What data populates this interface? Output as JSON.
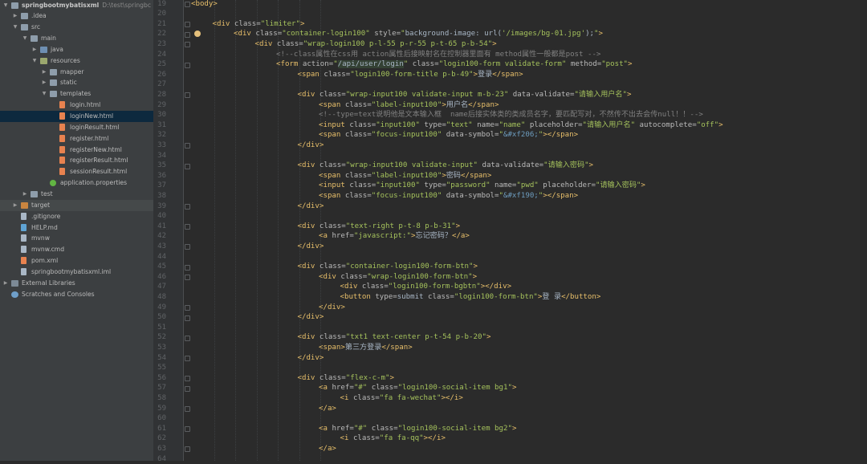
{
  "project_tree": [
    {
      "label": "springbootmybatisxml",
      "path": "D:\\test\\springbc",
      "depth": 0,
      "arrow": "down",
      "icon": "folder",
      "bold": true
    },
    {
      "label": ".idea",
      "depth": 1,
      "arrow": "right",
      "icon": "folder"
    },
    {
      "label": "src",
      "depth": 1,
      "arrow": "down",
      "icon": "folder"
    },
    {
      "label": "main",
      "depth": 2,
      "arrow": "down",
      "icon": "folder"
    },
    {
      "label": "java",
      "depth": 3,
      "arrow": "right",
      "icon": "folder src"
    },
    {
      "label": "resources",
      "depth": 3,
      "arrow": "down",
      "icon": "folder res"
    },
    {
      "label": "mapper",
      "depth": 4,
      "arrow": "right",
      "icon": "folder"
    },
    {
      "label": "static",
      "depth": 4,
      "arrow": "right",
      "icon": "folder"
    },
    {
      "label": "templates",
      "depth": 4,
      "arrow": "down",
      "icon": "folder"
    },
    {
      "label": "login.html",
      "depth": 5,
      "icon": "html"
    },
    {
      "label": "loginNew.html",
      "depth": 5,
      "icon": "html",
      "selected": true
    },
    {
      "label": "loginResult.html",
      "depth": 5,
      "icon": "html"
    },
    {
      "label": "register.html",
      "depth": 5,
      "icon": "html"
    },
    {
      "label": "registerNew.html",
      "depth": 5,
      "icon": "html"
    },
    {
      "label": "registerResult.html",
      "depth": 5,
      "icon": "html"
    },
    {
      "label": "sessionResult.html",
      "depth": 5,
      "icon": "html"
    },
    {
      "label": "application.properties",
      "depth": 4,
      "icon": "props"
    },
    {
      "label": "test",
      "depth": 2,
      "arrow": "right",
      "icon": "folder"
    },
    {
      "label": "target",
      "depth": 1,
      "arrow": "right",
      "icon": "folder tgt",
      "excluded": true
    },
    {
      "label": ".gitignore",
      "depth": 1,
      "icon": "file"
    },
    {
      "label": "HELP.md",
      "depth": 1,
      "icon": "md"
    },
    {
      "label": "mvnw",
      "depth": 1,
      "icon": "file"
    },
    {
      "label": "mvnw.cmd",
      "depth": 1,
      "icon": "file"
    },
    {
      "label": "pom.xml",
      "depth": 1,
      "icon": "xml"
    },
    {
      "label": "springbootmybatisxml.iml",
      "depth": 1,
      "icon": "file"
    },
    {
      "label": "External Libraries",
      "depth": 0,
      "arrow": "right",
      "icon": "lib"
    },
    {
      "label": "Scratches and Consoles",
      "depth": 0,
      "icon": "scratch"
    }
  ],
  "editor": {
    "first_line": 19,
    "lines": [
      {
        "indent": 0,
        "tokens": [
          [
            "tag",
            "<body>"
          ]
        ]
      },
      {
        "indent": 0,
        "tokens": []
      },
      {
        "indent": 1,
        "tokens": [
          [
            "tag",
            "<div "
          ],
          [
            "attr",
            "class="
          ],
          [
            "str",
            "\"limiter\""
          ],
          [
            "tag",
            ">"
          ]
        ]
      },
      {
        "indent": 2,
        "tokens": [
          [
            "tag",
            "<div "
          ],
          [
            "attr",
            "class="
          ],
          [
            "str",
            "\"container-login100\" "
          ],
          [
            "attr",
            "style="
          ],
          [
            "str",
            "\""
          ],
          [
            "txt",
            "background-image"
          ],
          [
            "txt",
            ": url("
          ],
          [
            "str",
            "'/images/bg-01.jpg'"
          ],
          [
            "txt",
            ");"
          ],
          [
            "str",
            "\""
          ],
          [
            "tag",
            ">"
          ]
        ]
      },
      {
        "indent": 3,
        "tokens": [
          [
            "tag",
            "<div "
          ],
          [
            "attr",
            "class="
          ],
          [
            "str",
            "\"wrap-login100 p-l-55 p-r-55 p-t-65 p-b-54\""
          ],
          [
            "tag",
            ">"
          ]
        ]
      },
      {
        "indent": 4,
        "tokens": [
          [
            "cmt",
            "<!--class属性在css用 action属性后接映射名在控制器里面有 method属性一般都是post -->"
          ]
        ]
      },
      {
        "indent": 4,
        "tokens": [
          [
            "tag",
            "<form "
          ],
          [
            "attr",
            "action="
          ],
          [
            "str",
            "\""
          ],
          [
            "hl",
            "/api/user/login"
          ],
          [
            "str",
            "\" "
          ],
          [
            "attr",
            "class="
          ],
          [
            "str",
            "\"login100-form validate-form\" "
          ],
          [
            "attr",
            "method="
          ],
          [
            "str",
            "\"post\""
          ],
          [
            "tag",
            ">"
          ]
        ]
      },
      {
        "indent": 5,
        "tokens": [
          [
            "tag",
            "<span "
          ],
          [
            "attr",
            "class="
          ],
          [
            "str",
            "\"login100-form-title p-b-49\""
          ],
          [
            "tag",
            ">"
          ],
          [
            "txt",
            "登录"
          ],
          [
            "tag",
            "</span>"
          ]
        ]
      },
      {
        "indent": 0,
        "tokens": []
      },
      {
        "indent": 5,
        "tokens": [
          [
            "tag",
            "<div "
          ],
          [
            "attr",
            "class="
          ],
          [
            "str",
            "\"wrap-input100 validate-input m-b-23\" "
          ],
          [
            "attr",
            "data-validate="
          ],
          [
            "str",
            "\"请输入用户名\""
          ],
          [
            "tag",
            ">"
          ]
        ]
      },
      {
        "indent": 6,
        "tokens": [
          [
            "tag",
            "<span "
          ],
          [
            "attr",
            "class="
          ],
          [
            "str",
            "\"label-input100\""
          ],
          [
            "tag",
            ">"
          ],
          [
            "txt",
            "用户名"
          ],
          [
            "tag",
            "</span>"
          ]
        ]
      },
      {
        "indent": 6,
        "tokens": [
          [
            "cmt",
            "<!--type=text说明他是文本输入框  name后接实体类的类成员名字，要匹配写对，不然传不出去会传null！！-->"
          ]
        ]
      },
      {
        "indent": 6,
        "tokens": [
          [
            "tag",
            "<input "
          ],
          [
            "attr",
            "class="
          ],
          [
            "str",
            "\"input100\" "
          ],
          [
            "attr",
            "type="
          ],
          [
            "str",
            "\"text\" "
          ],
          [
            "attr",
            "name="
          ],
          [
            "str",
            "\"name\" "
          ],
          [
            "attr",
            "placeholder="
          ],
          [
            "str",
            "\"请输入用户名\" "
          ],
          [
            "attr",
            "autocomplete="
          ],
          [
            "str",
            "\"off\""
          ],
          [
            "tag",
            ">"
          ]
        ]
      },
      {
        "indent": 6,
        "tokens": [
          [
            "tag",
            "<span "
          ],
          [
            "attr",
            "class="
          ],
          [
            "str",
            "\"focus-input100\" "
          ],
          [
            "attr",
            "data-symbol="
          ],
          [
            "str",
            "\""
          ],
          [
            "ent",
            "&#xf206;"
          ],
          [
            "str",
            "\""
          ],
          [
            "tag",
            "></span>"
          ]
        ]
      },
      {
        "indent": 5,
        "tokens": [
          [
            "tag",
            "</div>"
          ]
        ]
      },
      {
        "indent": 0,
        "tokens": []
      },
      {
        "indent": 5,
        "tokens": [
          [
            "tag",
            "<div "
          ],
          [
            "attr",
            "class="
          ],
          [
            "str",
            "\"wrap-input100 validate-input\" "
          ],
          [
            "attr",
            "data-validate="
          ],
          [
            "str",
            "\"请输入密码\""
          ],
          [
            "tag",
            ">"
          ]
        ]
      },
      {
        "indent": 6,
        "tokens": [
          [
            "tag",
            "<span "
          ],
          [
            "attr",
            "class="
          ],
          [
            "str",
            "\"label-input100\""
          ],
          [
            "tag",
            ">"
          ],
          [
            "txt",
            "密码"
          ],
          [
            "tag",
            "</span>"
          ]
        ]
      },
      {
        "indent": 6,
        "tokens": [
          [
            "tag",
            "<input "
          ],
          [
            "attr",
            "class="
          ],
          [
            "str",
            "\"input100\" "
          ],
          [
            "attr",
            "type="
          ],
          [
            "str",
            "\"password\" "
          ],
          [
            "attr",
            "name="
          ],
          [
            "str",
            "\"pwd\" "
          ],
          [
            "attr",
            "placeholder="
          ],
          [
            "str",
            "\"请输入密码\""
          ],
          [
            "tag",
            ">"
          ]
        ]
      },
      {
        "indent": 6,
        "tokens": [
          [
            "tag",
            "<span "
          ],
          [
            "attr",
            "class="
          ],
          [
            "str",
            "\"focus-input100\" "
          ],
          [
            "attr",
            "data-symbol="
          ],
          [
            "str",
            "\""
          ],
          [
            "ent",
            "&#xf190;"
          ],
          [
            "str",
            "\""
          ],
          [
            "tag",
            "></span>"
          ]
        ]
      },
      {
        "indent": 5,
        "tokens": [
          [
            "tag",
            "</div>"
          ]
        ]
      },
      {
        "indent": 0,
        "tokens": []
      },
      {
        "indent": 5,
        "tokens": [
          [
            "tag",
            "<div "
          ],
          [
            "attr",
            "class="
          ],
          [
            "str",
            "\"text-right p-t-8 p-b-31\""
          ],
          [
            "tag",
            ">"
          ]
        ]
      },
      {
        "indent": 6,
        "tokens": [
          [
            "tag",
            "<a "
          ],
          [
            "attr",
            "href="
          ],
          [
            "str",
            "\"javascript:\""
          ],
          [
            "tag",
            ">"
          ],
          [
            "txt",
            "忘记密码？"
          ],
          [
            "tag",
            "</a>"
          ]
        ]
      },
      {
        "indent": 5,
        "tokens": [
          [
            "tag",
            "</div>"
          ]
        ]
      },
      {
        "indent": 0,
        "tokens": []
      },
      {
        "indent": 5,
        "tokens": [
          [
            "tag",
            "<div "
          ],
          [
            "attr",
            "class="
          ],
          [
            "str",
            "\"container-login100-form-btn\""
          ],
          [
            "tag",
            ">"
          ]
        ]
      },
      {
        "indent": 6,
        "tokens": [
          [
            "tag",
            "<div "
          ],
          [
            "attr",
            "class="
          ],
          [
            "str",
            "\"wrap-login100-form-btn\""
          ],
          [
            "tag",
            ">"
          ]
        ]
      },
      {
        "indent": 7,
        "tokens": [
          [
            "tag",
            "<div "
          ],
          [
            "attr",
            "class="
          ],
          [
            "str",
            "\"login100-form-bgbtn\""
          ],
          [
            "tag",
            "></div>"
          ]
        ]
      },
      {
        "indent": 7,
        "tokens": [
          [
            "tag",
            "<button "
          ],
          [
            "attr",
            "type="
          ],
          [
            "txt",
            "submit "
          ],
          [
            "attr",
            "class="
          ],
          [
            "str",
            "\"login100-form-btn\""
          ],
          [
            "tag",
            ">"
          ],
          [
            "txt",
            "登 录"
          ],
          [
            "tag",
            "</button>"
          ]
        ]
      },
      {
        "indent": 6,
        "tokens": [
          [
            "tag",
            "</div>"
          ]
        ]
      },
      {
        "indent": 5,
        "tokens": [
          [
            "tag",
            "</div>"
          ]
        ]
      },
      {
        "indent": 0,
        "tokens": []
      },
      {
        "indent": 5,
        "tokens": [
          [
            "tag",
            "<div "
          ],
          [
            "attr",
            "class="
          ],
          [
            "str",
            "\"txt1 text-center p-t-54 p-b-20\""
          ],
          [
            "tag",
            ">"
          ]
        ]
      },
      {
        "indent": 6,
        "tokens": [
          [
            "tag",
            "<span>"
          ],
          [
            "txt",
            "第三方登录"
          ],
          [
            "tag",
            "</span>"
          ]
        ]
      },
      {
        "indent": 5,
        "tokens": [
          [
            "tag",
            "</div>"
          ]
        ]
      },
      {
        "indent": 0,
        "tokens": []
      },
      {
        "indent": 5,
        "tokens": [
          [
            "tag",
            "<div "
          ],
          [
            "attr",
            "class="
          ],
          [
            "str",
            "\"flex-c-m\""
          ],
          [
            "tag",
            ">"
          ]
        ]
      },
      {
        "indent": 6,
        "tokens": [
          [
            "tag",
            "<a "
          ],
          [
            "attr",
            "href="
          ],
          [
            "str",
            "\"#\" "
          ],
          [
            "attr",
            "class="
          ],
          [
            "str",
            "\"login100-social-item bg1\""
          ],
          [
            "tag",
            ">"
          ]
        ]
      },
      {
        "indent": 7,
        "tokens": [
          [
            "tag",
            "<i "
          ],
          [
            "attr",
            "class="
          ],
          [
            "str",
            "\"fa fa-wechat\""
          ],
          [
            "tag",
            "></i>"
          ]
        ]
      },
      {
        "indent": 6,
        "tokens": [
          [
            "tag",
            "</a>"
          ]
        ]
      },
      {
        "indent": 0,
        "tokens": []
      },
      {
        "indent": 6,
        "tokens": [
          [
            "tag",
            "<a "
          ],
          [
            "attr",
            "href="
          ],
          [
            "str",
            "\"#\" "
          ],
          [
            "attr",
            "class="
          ],
          [
            "str",
            "\"login100-social-item bg2\""
          ],
          [
            "tag",
            ">"
          ]
        ]
      },
      {
        "indent": 7,
        "tokens": [
          [
            "tag",
            "<i "
          ],
          [
            "attr",
            "class="
          ],
          [
            "str",
            "\"fa fa-qq\""
          ],
          [
            "tag",
            "></i>"
          ]
        ]
      },
      {
        "indent": 6,
        "tokens": [
          [
            "tag",
            "</a>"
          ]
        ]
      },
      {
        "indent": 0,
        "tokens": []
      }
    ]
  },
  "colors": {
    "tag": "#e8bf6a",
    "attr": "#bababa",
    "string": "#a5c25c",
    "comment": "#808080",
    "text": "#a9b7c6",
    "background": "#2b2b2b",
    "tree_bg": "#3c3f41",
    "selection": "#0d293e"
  }
}
